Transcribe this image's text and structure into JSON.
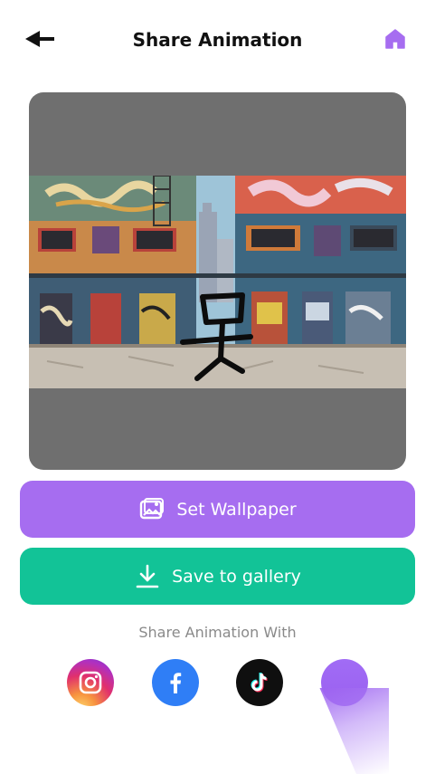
{
  "header": {
    "title": "Share Animation",
    "back_icon": "arrow-left-icon",
    "home_icon": "home-icon"
  },
  "preview": {
    "background": "#6f6f6f",
    "image": "graffiti-street-scene-with-stick-figure"
  },
  "actions": {
    "set_wallpaper_label": "Set Wallpaper",
    "set_wallpaper_icon": "image-icon",
    "save_gallery_label": "Save to gallery",
    "save_gallery_icon": "download-icon"
  },
  "share": {
    "label": "Share Animation With",
    "targets": [
      "instagram",
      "facebook",
      "tiktok",
      "more"
    ]
  },
  "colors": {
    "accent_purple": "#a66df0",
    "accent_green": "#12c397",
    "facebook_blue": "#2f7ef6"
  }
}
